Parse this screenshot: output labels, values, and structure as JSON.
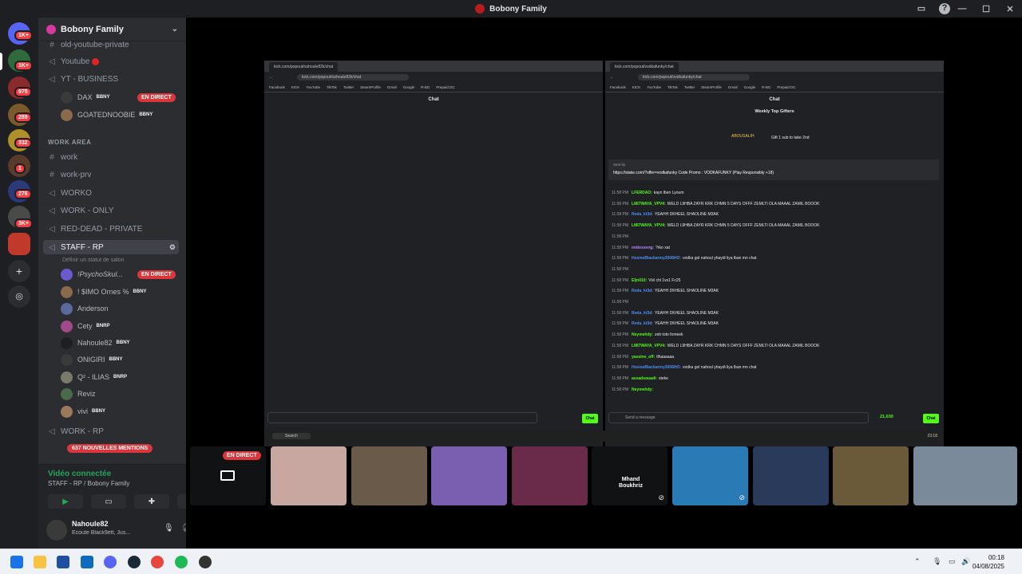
{
  "window": {
    "title": "Bobony Family"
  },
  "servers": {
    "badges": [
      "1K+",
      "1K+",
      "975",
      "289",
      "332",
      "1",
      "276",
      "3K+"
    ]
  },
  "guild": {
    "name": "Bobony Family"
  },
  "channels": {
    "old_youtube": "old-youtube-private",
    "youtube": "Youtube",
    "yt_business": "YT - BUSINESS",
    "work_area_category": "WORK AREA",
    "work": "work",
    "work_prv": "work-prv",
    "work_o": "WORKO",
    "work_only": "WORK - ONLY",
    "red_dead": "RED-DEAD - PRIVATE",
    "staff_rp": "STAFF - RP",
    "staff_rp_status": "Définir un statut de salon",
    "work_rp": "WORK - RP"
  },
  "users": {
    "dax": "DAX",
    "goated": "GOATEDNOOBIE",
    "psycho": "!PsychoSkul...",
    "simo": "! $IMO Ornes %",
    "anderson": "Anderson",
    "cety": "Cety",
    "nahoule": "Nahoule82",
    "onigiri": "ONIGIRI",
    "q2": "Q² - ILIAS",
    "reviz": "Reviz",
    "vivi": "vivi"
  },
  "tags": {
    "bbny": "BBNY",
    "bnrp": "BNRP"
  },
  "live_label": "EN DIRECT",
  "mentions_label": "637 NOUVELLES MENTIONS",
  "voice": {
    "status": "Vidéo connectée",
    "channel": "STAFF - RP / Bobony Family"
  },
  "user_panel": {
    "name": "Nahoule82",
    "activity": "Écoute Black9ett, Jus..."
  },
  "browser_left": {
    "tab": "kick.com/popout/nahoule82k/chat",
    "url": "kick.com/popout/nahoule82k/chat",
    "heading": "Chat",
    "chat_button": "Chat"
  },
  "browser_right": {
    "tab": "kick.com/popout/vodkafunky/chat",
    "url": "kick.com/popout/vodkafunky/chat",
    "heading": "Chat",
    "gifters_title": "Weekly Top Gifters",
    "gifter_name": "ABOUSALIH",
    "gifter_hint": "Gift 1 sub to take 2nd",
    "pinned_by": "Sent by",
    "pinned_msg": "https://stake.com/?offer=vodkafunky Code Promo : VODKAFUNKY (Play Responsibly +18)",
    "placeholder": "Send a message",
    "points": "21,030",
    "chat_button": "Chat",
    "messages": [
      {
        "time": "11:58 PM",
        "user": "LFERDAO:",
        "text": "kayn lben Lyoum",
        "color": "g"
      },
      {
        "time": "11:58 PM",
        "user": "LMI7WAYA_VPV4:",
        "text": "WELD L9HBA ZAYR KRK CHMN 5 DAYS OFFF ZEMLTI OLA MAAAL ZAMIL BOOOK",
        "color": "g"
      },
      {
        "time": "11:58 PM",
        "user": "Reda_kt3d:",
        "text": "YEAHH DKHEEL SHAOLINE M3AK",
        "color": "b"
      },
      {
        "time": "11:58 PM",
        "user": "LMI7WAYA_VPV4:",
        "text": "WELD L9HBA ZAYR KRK CHMN 5 DAYS OFFF ZEMLTI OLA MAAAL ZAMIL BOOOK",
        "color": "g"
      },
      {
        "time": "11:58 PM",
        "user": "",
        "text": "",
        "color": "r"
      },
      {
        "time": "11:58 PM",
        "user": "midosxeng:",
        "text": "?rko xat",
        "color": "p"
      },
      {
        "time": "11:58 PM",
        "user": "HssineBlackarmy2006HO:",
        "text": "vodka gol nahoul yhaydi liya lban mn chat",
        "color": "b"
      },
      {
        "time": "11:58 PM",
        "user": "",
        "text": "",
        "color": "r"
      },
      {
        "time": "11:58 PM",
        "user": "Eljn010:",
        "text": "Vivl chi 1vs1 Fc25",
        "color": "g"
      },
      {
        "time": "11:58 PM",
        "user": "Reda_kt3d:",
        "text": "YEAHH DKHEEL SHAOLINE M3AK",
        "color": "b"
      },
      {
        "time": "11:58 PM",
        "user": "",
        "text": "",
        "color": "r"
      },
      {
        "time": "11:58 PM",
        "user": "Reda_kt3d:",
        "text": "YEAHH DKHEEL SHAOLINE M3AK",
        "color": "b"
      },
      {
        "time": "11:58 PM",
        "user": "Reda_kt3d:",
        "text": "YEAHH DKHEEL SHAOLINE M3AK",
        "color": "b"
      },
      {
        "time": "11:58 PM",
        "user": "Neymehdy:",
        "text": "zeb toto fomeek",
        "color": "g"
      },
      {
        "time": "11:58 PM",
        "user": "LMI7WAYA_VPV4:",
        "text": "WELD L9HBA ZAYR KRK CHMN 5 DAYS OFFF ZEMLTI OLA MAAAL ZAMIL BOOOK",
        "color": "g"
      },
      {
        "time": "11:58 PM",
        "user": "yassine_off:",
        "text": "tlhaaaaaa",
        "color": "g"
      },
      {
        "time": "11:58 PM",
        "user": "HssineBlackarmy2006HO:",
        "text": "vodka gol nahoul yhaydi liya lban mn chat",
        "color": "b"
      },
      {
        "time": "11:58 PM",
        "user": "assadsouadi:",
        "text": "steke",
        "color": "g"
      },
      {
        "time": "11:58 PM",
        "user": "Neymehdy:",
        "text": "",
        "color": "g"
      }
    ]
  },
  "bookmarks": [
    "Facebook",
    "KICK",
    "YouTube",
    "TikTok",
    "Twitter",
    "SteamProfile",
    "Gmail",
    "Google",
    "R-BG",
    "Prepaid DC"
  ],
  "mini_taskbar": {
    "search": "Search",
    "time": "23:18"
  },
  "participants": {
    "live_label": "EN DIRECT",
    "tile5_name": "Mhand Boukhriz"
  },
  "taskbar": {
    "time": "00:18",
    "date": "04/08/2025"
  }
}
